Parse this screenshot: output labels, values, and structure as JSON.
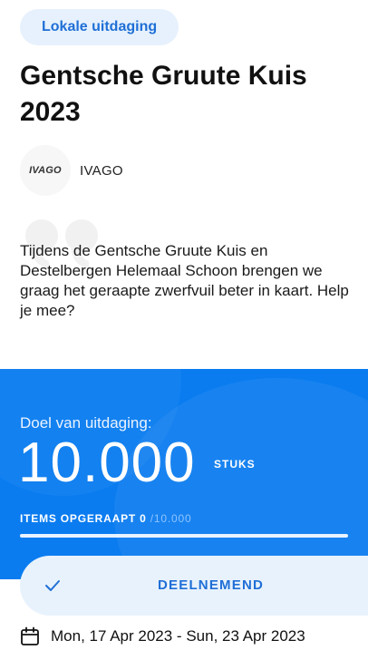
{
  "challenge": {
    "type_label": "Lokale uitdaging",
    "title": "Gentsche Gruute Kuis 2023",
    "organizer": {
      "logo_text": "IVAGO",
      "name": "IVAGO"
    },
    "description": "Tijdens de Gentsche Gruute Kuis en Destelbergen Helemaal Schoon brengen we graag het geraapte zwerfvuil beter in kaart. Help je mee?"
  },
  "goal": {
    "label": "Doel van uitdaging:",
    "value": "10.000",
    "unit": "STUKS",
    "collected_label": "ITEMS OPGERAAPT",
    "collected_value": "0",
    "collected_total": "/10.000",
    "progress_fraction": 0
  },
  "actions": {
    "join_label": "DEELNEMEND"
  },
  "dates": {
    "range": "Mon, 17 Apr 2023 - Sun, 23 Apr 2023"
  },
  "colors": {
    "accent": "#0a7cf0",
    "chip_bg": "#e6f1fd",
    "link": "#1f6fd6"
  },
  "icons": {
    "quote": "quote-icon",
    "check": "check-icon",
    "calendar": "calendar-icon"
  }
}
